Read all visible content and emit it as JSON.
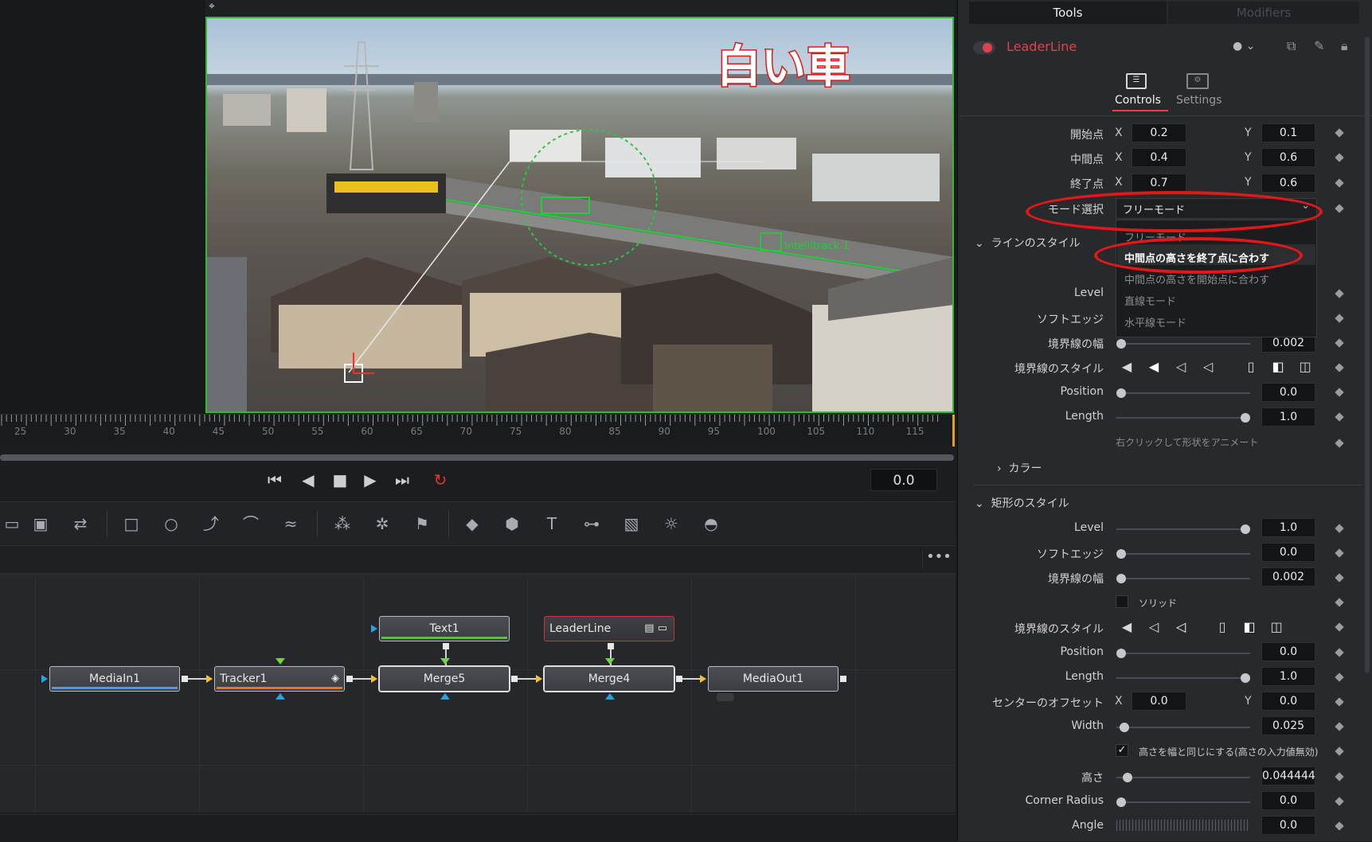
{
  "viewer": {
    "overlay_text": "白い車",
    "tracker_label": "Intellitrack 1"
  },
  "ruler": {
    "ticks": [
      "25",
      "30",
      "35",
      "40",
      "45",
      "50",
      "55",
      "60",
      "65",
      "70",
      "75",
      "80",
      "85",
      "90",
      "95",
      "100",
      "105",
      "110",
      "115"
    ]
  },
  "transport": {
    "timecode": "0.0"
  },
  "nodes": {
    "mediain": "MediaIn1",
    "tracker": "Tracker1",
    "text": "Text1",
    "merge5": "Merge5",
    "leaderline": "LeaderLine",
    "merge4": "Merge4",
    "mediaout": "MediaOut1"
  },
  "inspector": {
    "tabs": {
      "tools": "Tools",
      "modifiers": "Modifiers"
    },
    "tool_name": "LeaderLine",
    "subtabs": {
      "controls": "Controls",
      "settings": "Settings"
    },
    "start": {
      "label": "開始点",
      "x": "0.2",
      "y": "0.1"
    },
    "mid": {
      "label": "中間点",
      "x": "0.4",
      "y": "0.6"
    },
    "end": {
      "label": "終了点",
      "x": "0.7",
      "y": "0.6"
    },
    "axis_x": "X",
    "axis_y": "Y",
    "mode": {
      "label": "モード選択",
      "value": "フリーモード"
    },
    "dropdown_options": [
      "フリーモード",
      "中間点の高さを終了点に合わす",
      "中間点の高さを開始点に合わす",
      "直線モード",
      "水平線モード"
    ],
    "line_style": {
      "title": "ラインのスタイル",
      "level": "Level",
      "soft_edge": "ソフトエッジ",
      "border_width": {
        "label": "境界線の幅",
        "value": "0.002"
      },
      "border_style": "境界線のスタイル",
      "position": {
        "label": "Position",
        "value": "0.0"
      },
      "length": {
        "label": "Length",
        "value": "1.0"
      },
      "hint": "右クリックして形状をアニメート"
    },
    "color_section": "カラー",
    "rect_style": {
      "title": "矩形のスタイル",
      "level": {
        "label": "Level",
        "value": "1.0"
      },
      "soft_edge": {
        "label": "ソフトエッジ",
        "value": "0.0"
      },
      "border_width": {
        "label": "境界線の幅",
        "value": "0.002"
      },
      "solid": "ソリッド",
      "border_style": "境界線のスタイル",
      "position": {
        "label": "Position",
        "value": "0.0"
      },
      "length": {
        "label": "Length",
        "value": "1.0"
      },
      "center_offset": {
        "label": "センターのオフセット",
        "x": "0.0",
        "y": "0.0"
      },
      "width": {
        "label": "Width",
        "value": "0.025"
      },
      "same_height": "高さを幅と同じにする(高さの入力値無効)",
      "height": {
        "label": "高さ",
        "value": "0.044444"
      },
      "corner_radius": {
        "label": "Corner Radius",
        "value": "0.0"
      },
      "angle": {
        "label": "Angle",
        "value": "0.0"
      }
    }
  },
  "colors": {
    "accent_red": "#e01818",
    "tool_name": "#e0414a",
    "node_bar_tracker": "#e07a1f",
    "node_bar_media": "#5e95d6",
    "node_bar_text": "#5dbb46"
  }
}
